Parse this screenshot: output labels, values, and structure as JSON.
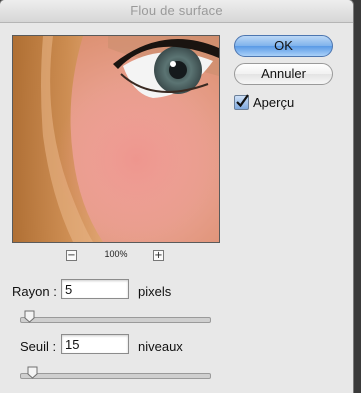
{
  "window": {
    "title": "Flou de surface"
  },
  "preview": {
    "zoom": "100%"
  },
  "buttons": {
    "ok": "OK",
    "cancel": "Annuler"
  },
  "preview_toggle": {
    "label": "Aperçu",
    "checked": true
  },
  "radius": {
    "label": "Rayon :",
    "value": "5",
    "unit": "pixels",
    "slider_fraction": 0.02
  },
  "threshold": {
    "label": "Seuil :",
    "value": "15",
    "unit": "niveaux",
    "slider_fraction": 0.04
  },
  "colors": {
    "accent": "#5a9ae6"
  }
}
